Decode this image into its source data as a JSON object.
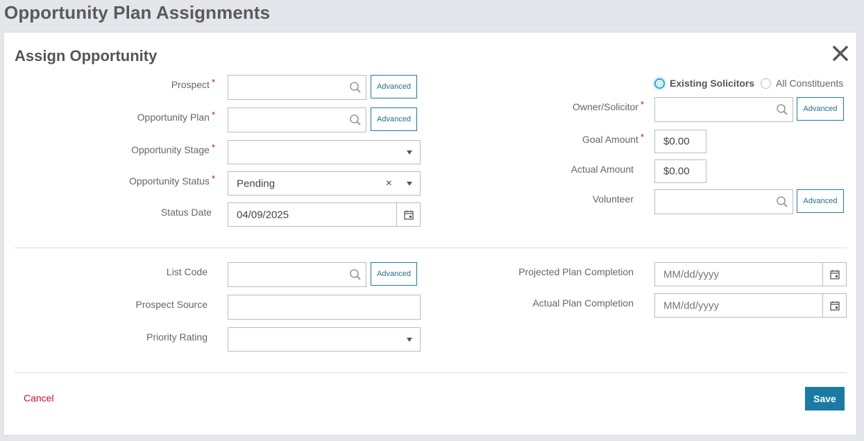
{
  "page": {
    "title": "Opportunity Plan Assignments"
  },
  "modal": {
    "title": "Assign Opportunity",
    "advanced_label": "Advanced",
    "left": {
      "prospect": {
        "label": "Prospect",
        "value": ""
      },
      "opportunity_plan": {
        "label": "Opportunity Plan",
        "value": ""
      },
      "opportunity_stage": {
        "label": "Opportunity Stage",
        "value": ""
      },
      "opportunity_status": {
        "label": "Opportunity Status",
        "value": "Pending",
        "clear_glyph": "×"
      },
      "status_date": {
        "label": "Status Date",
        "value": "04/09/2025"
      },
      "list_code": {
        "label": "List Code",
        "value": ""
      },
      "prospect_source": {
        "label": "Prospect Source",
        "value": ""
      },
      "priority_rating": {
        "label": "Priority Rating",
        "value": ""
      }
    },
    "right": {
      "radio_existing": {
        "label": "Existing Solicitors",
        "selected": true
      },
      "radio_all": {
        "label": "All Constituents",
        "selected": false
      },
      "owner_solicitor": {
        "label": "Owner/Solicitor",
        "value": ""
      },
      "goal_amount": {
        "label": "Goal Amount",
        "value": "$0.00"
      },
      "actual_amount": {
        "label": "Actual Amount",
        "value": "$0.00"
      },
      "volunteer": {
        "label": "Volunteer",
        "value": ""
      },
      "projected_plan_completion": {
        "label": "Projected Plan Completion",
        "placeholder": "MM/dd/yyyy"
      },
      "actual_plan_completion": {
        "label": "Actual Plan Completion",
        "placeholder": "MM/dd/yyyy"
      }
    },
    "footer": {
      "cancel_label": "Cancel",
      "save_label": "Save"
    },
    "required_marker": "*"
  },
  "colors": {
    "accent": "#1a7aa3",
    "required": "#c8102e",
    "cancel": "#c8102e",
    "radio_active": "#2aa3d6"
  },
  "icons": [
    "search-icon",
    "calendar-icon",
    "close-icon",
    "chevron-down-icon",
    "clear-icon"
  ]
}
